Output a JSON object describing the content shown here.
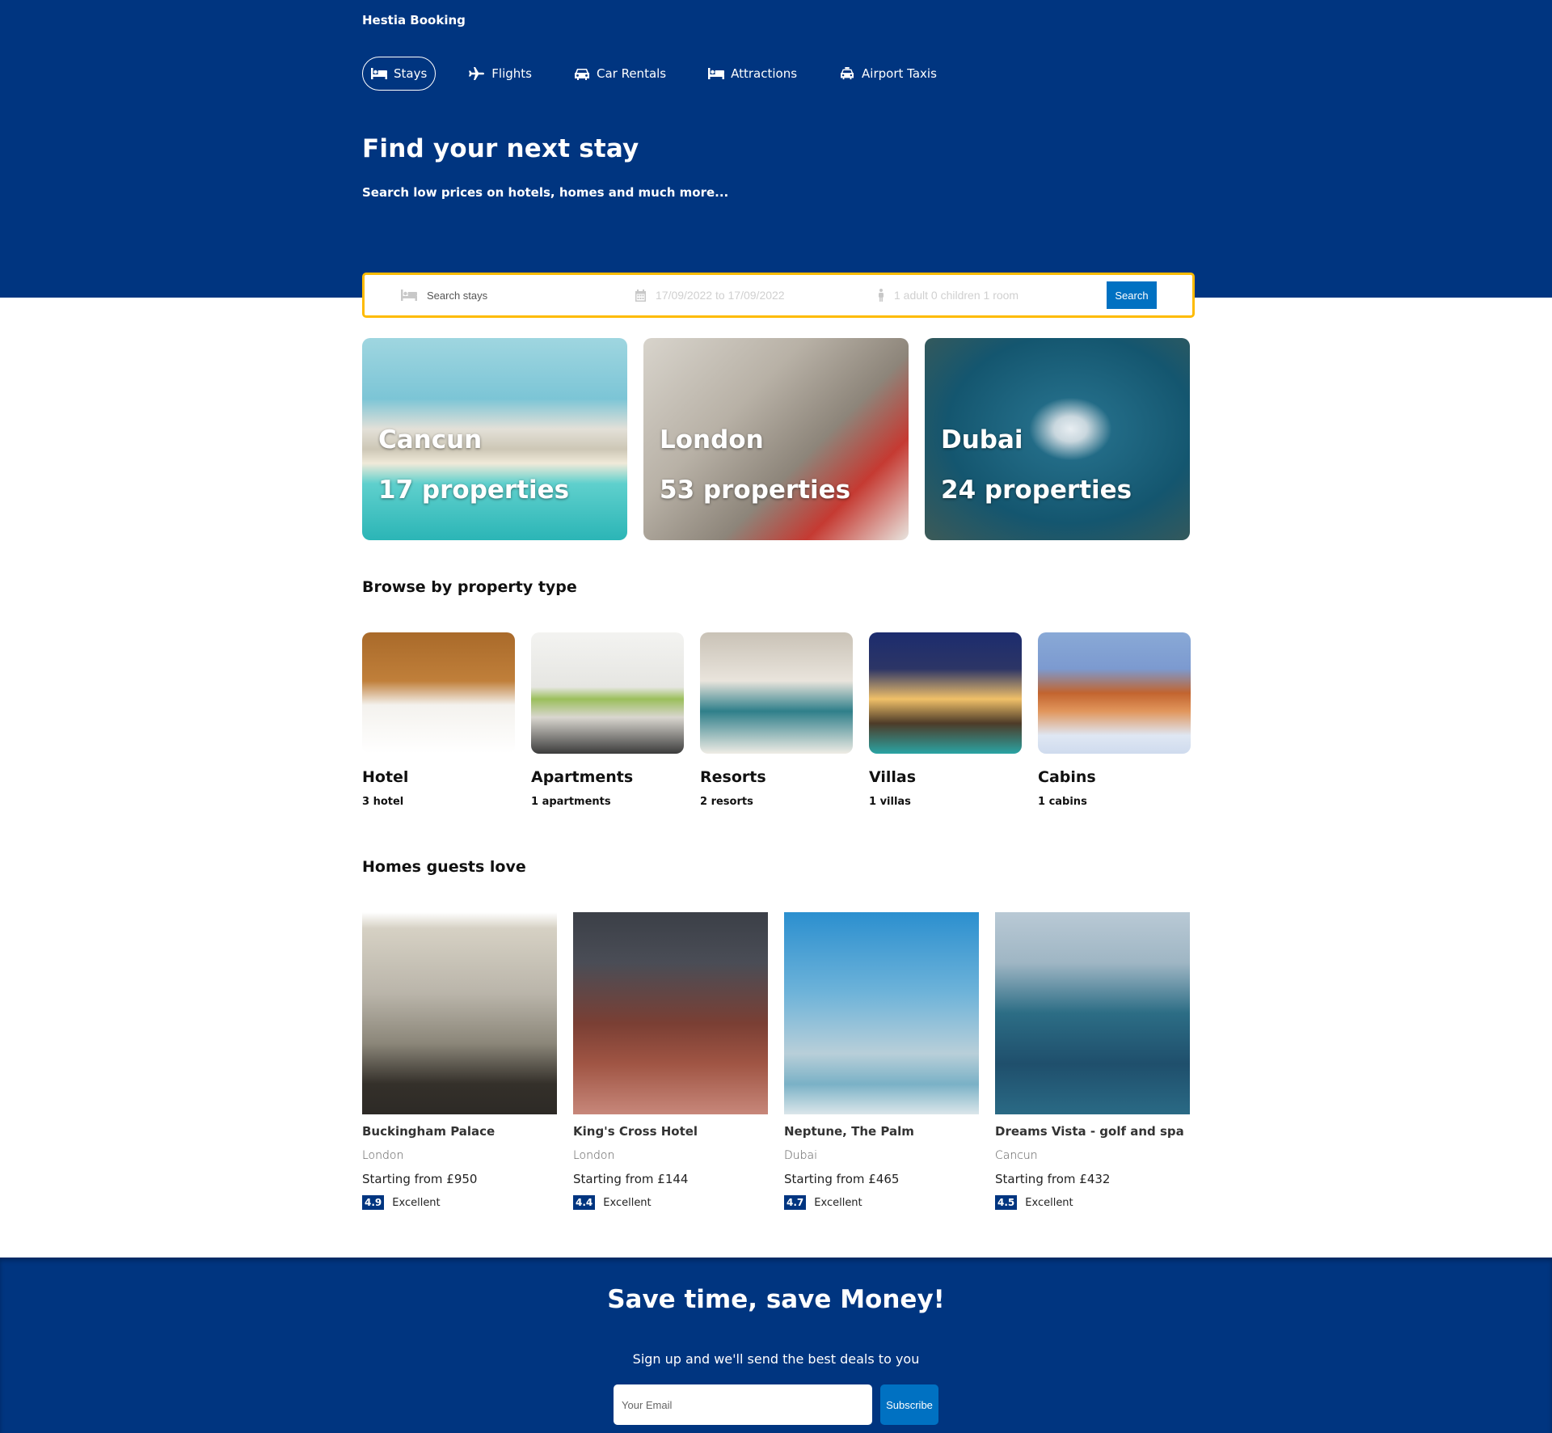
{
  "header": {
    "brand": "Hestia Booking",
    "nav": [
      {
        "label": "Stays",
        "icon": "bed-icon",
        "active": true
      },
      {
        "label": "Flights",
        "icon": "plane-icon",
        "active": false
      },
      {
        "label": "Car Rentals",
        "icon": "car-icon",
        "active": false
      },
      {
        "label": "Attractions",
        "icon": "bed-icon",
        "active": false
      },
      {
        "label": "Airport Taxis",
        "icon": "taxi-icon",
        "active": false
      }
    ],
    "title": "Find your next stay",
    "subtitle": "Search low prices on hotels, homes and much more..."
  },
  "search": {
    "destination_placeholder": "Search stays",
    "dates": "17/09/2022 to 17/09/2022",
    "options": "1 adult 0 children 1 room",
    "button": "Search"
  },
  "featured": [
    {
      "city": "Cancun",
      "count": "17 properties"
    },
    {
      "city": "London",
      "count": "53 properties"
    },
    {
      "city": "Dubai",
      "count": "24 properties"
    }
  ],
  "property_types": {
    "title": "Browse by property type",
    "items": [
      {
        "name": "Hotel",
        "count": "3 hotel"
      },
      {
        "name": "Apartments",
        "count": "1 apartments"
      },
      {
        "name": "Resorts",
        "count": "2 resorts"
      },
      {
        "name": "Villas",
        "count": "1 villas"
      },
      {
        "name": "Cabins",
        "count": "1 cabins"
      }
    ]
  },
  "homes": {
    "title": "Homes guests love",
    "items": [
      {
        "name": "Buckingham Palace",
        "city": "London",
        "price": "Starting from £950",
        "score": "4.9",
        "rating": "Excellent"
      },
      {
        "name": "King's Cross Hotel",
        "city": "London",
        "price": "Starting from £144",
        "score": "4.4",
        "rating": "Excellent"
      },
      {
        "name": "Neptune, The Palm",
        "city": "Dubai",
        "price": "Starting from £465",
        "score": "4.7",
        "rating": "Excellent"
      },
      {
        "name": "Dreams Vista - golf and spa",
        "city": "Cancun",
        "price": "Starting from £432",
        "score": "4.5",
        "rating": "Excellent"
      }
    ]
  },
  "newsletter": {
    "title": "Save time, save Money!",
    "subtitle": "Sign up and we'll send the best deals to you",
    "email_placeholder": "Your Email",
    "button": "Subscribe"
  },
  "colors": {
    "brand_blue": "#003580",
    "accent_blue": "#0071c2",
    "search_border": "#febb02"
  }
}
